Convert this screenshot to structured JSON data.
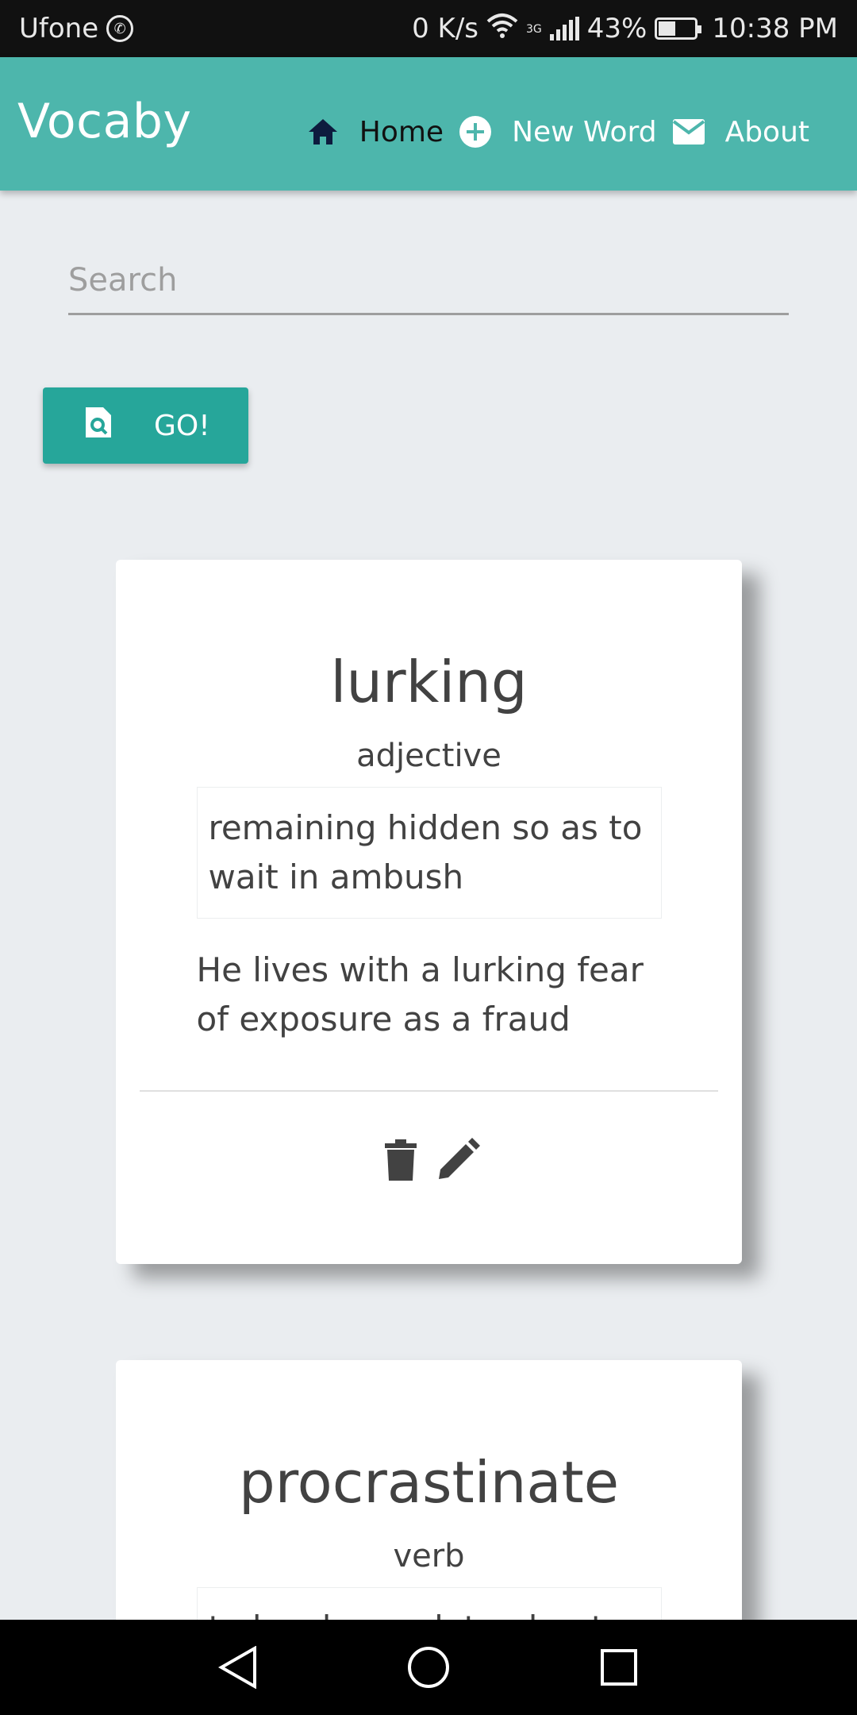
{
  "status_bar": {
    "carrier": "Ufone",
    "speed": "0 K/s",
    "network_type": "3G",
    "battery": "43%",
    "battery_level": 0.43,
    "time": "10:38 PM"
  },
  "app_bar": {
    "brand": "Vocaby",
    "nav": [
      {
        "label": "Home",
        "icon": "home-icon",
        "active": true
      },
      {
        "label": "New Word",
        "icon": "plus-circle-icon",
        "active": false
      },
      {
        "label": "About",
        "icon": "mail-icon",
        "active": false
      }
    ]
  },
  "search": {
    "placeholder": "Search",
    "value": "",
    "button_label": "GO!",
    "button_icon": "file-search-icon"
  },
  "cards": [
    {
      "word": "lurking",
      "part_of_speech": "adjective",
      "definition": "remaining hidden so as to wait in ambush",
      "example": "He lives with a lurking fear of exposure as a fraud"
    },
    {
      "word": "procrastinate",
      "part_of_speech": "verb",
      "definition": "to be slow or late about"
    }
  ],
  "colors": {
    "app_bar": "#4db6ac",
    "button": "#26a69a",
    "background": "#eaedf0",
    "text": "#424242"
  }
}
